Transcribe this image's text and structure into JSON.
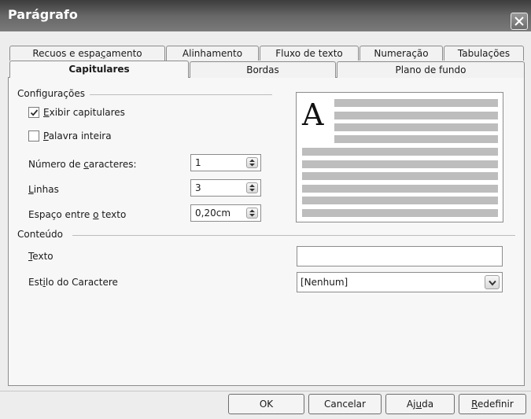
{
  "window": {
    "title": "Parágrafo"
  },
  "tabs_row1": [
    {
      "label": "Recuos e espaçamento"
    },
    {
      "label": "Alinhamento"
    },
    {
      "label": "Fluxo de texto"
    },
    {
      "label": "Numeração"
    },
    {
      "label": "Tabulações"
    }
  ],
  "tabs_row2": [
    {
      "label": "Capitulares",
      "active": true
    },
    {
      "label": "Bordas"
    },
    {
      "label": "Plano de fundo"
    }
  ],
  "config": {
    "section_label": "Configurações",
    "show_dropcaps": {
      "label": "Exibir capitulares",
      "checked": true
    },
    "whole_word": {
      "label": "Palavra inteira",
      "checked": false
    },
    "num_chars": {
      "label": "Número de caracteres:",
      "value": "1"
    },
    "lines": {
      "label": "Linhas",
      "value": "3"
    },
    "spacing": {
      "label": "Espaço entre o texto",
      "value": "0,20cm"
    }
  },
  "preview": {
    "dropcap_letter": "A"
  },
  "content": {
    "section_label": "Conteúdo",
    "text": {
      "label": "Texto",
      "value": ""
    },
    "char_style": {
      "label": "Estilo do Caractere",
      "value": "[Nenhum]"
    }
  },
  "buttons": {
    "ok": "OK",
    "cancel": "Cancelar",
    "help": "Ajuda",
    "reset": "Redefinir"
  },
  "icons": {
    "close": "close-icon",
    "check": "check-icon",
    "spin": "spin-arrows-icon",
    "dropdown": "chevron-down-icon"
  }
}
